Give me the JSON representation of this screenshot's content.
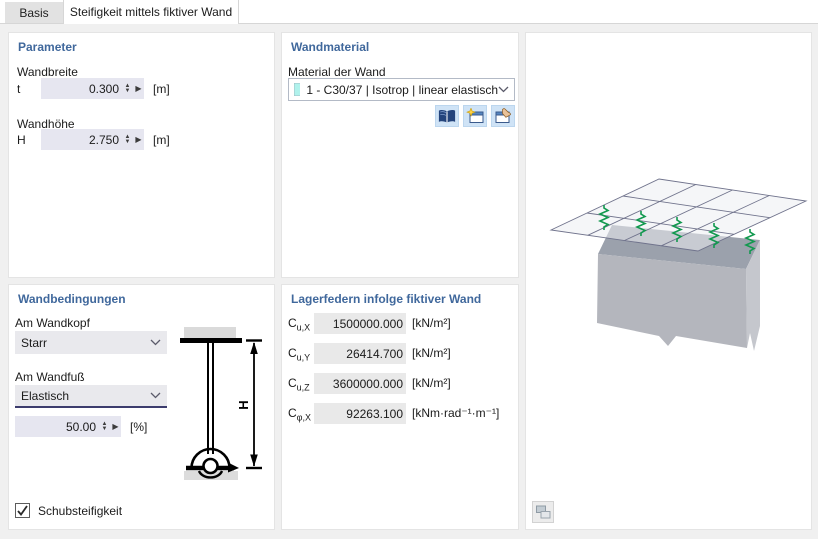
{
  "tabs": [
    {
      "label": "Basis",
      "active": false
    },
    {
      "label": "Steifigkeit mittels fiktiver Wand",
      "active": true
    }
  ],
  "parameter": {
    "title": "Parameter",
    "wandbreite_label": "Wandbreite",
    "t_symbol": "t",
    "t_value": "0.300",
    "t_unit": "[m]",
    "wandhoehe_label": "Wandhöhe",
    "h_symbol": "H",
    "h_value": "2.750",
    "h_unit": "[m]"
  },
  "wandmaterial": {
    "title": "Wandmaterial",
    "label": "Material der Wand",
    "selected": "1 - C30/37 | Isotrop | linear elastisch",
    "swatch_color": "#b0f2ec",
    "icons": [
      "book-library-icon",
      "new-window-star-icon",
      "edit-window-hand-icon"
    ]
  },
  "wandbedingungen": {
    "title": "Wandbedingungen",
    "kopf_label": "Am Wandkopf",
    "kopf_value": "Starr",
    "fuss_label": "Am Wandfuß",
    "fuss_value": "Elastisch",
    "fuss_percent_value": "50.00",
    "percent_unit": "[%]",
    "diagram_h_label": "H",
    "checkbox_label": "Schubsteifigkeit",
    "checkbox_checked": true
  },
  "lagerfedern": {
    "title": "Lagerfedern infolge fiktiver Wand",
    "rows": [
      {
        "symbol": "C",
        "sub": "u,X",
        "value": "1500000.000",
        "unit": "[kN/m²]"
      },
      {
        "symbol": "C",
        "sub": "u,Y",
        "value": "26414.700",
        "unit": "[kN/m²]"
      },
      {
        "symbol": "C",
        "sub": "u,Z",
        "value": "3600000.000",
        "unit": "[kN/m²]"
      },
      {
        "symbol": "C",
        "sub": "φ,X",
        "value": "92263.100",
        "unit": "[kNm·rad⁻¹·m⁻¹]"
      }
    ]
  },
  "viewport": {
    "description": "3D preview of fictitious wall with slab grid and support springs",
    "spring_color": "#12994f",
    "wall_front_color": "#b4b6bd",
    "wall_top_color": "#9ba1ac",
    "wall_side_color": "#c5c7cd",
    "tool_icon": "layers-icon-disabled"
  },
  "colors": {
    "panel_title": "#40689c",
    "field_editable": "#e6e6f0",
    "field_readonly": "#e9e9e9",
    "focus_underline": "#3c3c6d",
    "icon_button_bg": "#cfe3f6",
    "dialog_bg": "#f0f0f0"
  }
}
